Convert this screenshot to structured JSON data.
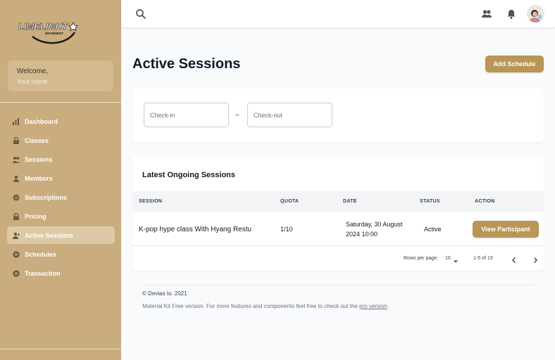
{
  "colors": {
    "sidebar": "#c9ad7f",
    "accent": "#b99655",
    "active_nav": "#ddc9a6"
  },
  "brand": {
    "logo_text": "LIMELIGHT",
    "logo_subtext": "MOVEMENT"
  },
  "welcome": {
    "title": "Welcome,",
    "name": "Your name"
  },
  "sidebar": {
    "items": [
      {
        "label": "Dashboard",
        "icon": "bar-chart-icon",
        "active": false
      },
      {
        "label": "Classes",
        "icon": "lock-icon",
        "active": false
      },
      {
        "label": "Sessions",
        "icon": "users-icon",
        "active": false
      },
      {
        "label": "Members",
        "icon": "user-icon",
        "active": false
      },
      {
        "label": "Subscriptions",
        "icon": "gear-icon",
        "active": false
      },
      {
        "label": "Pricing",
        "icon": "lock-icon",
        "active": false
      },
      {
        "label": "Active Sessions",
        "icon": "user-add-icon",
        "active": true
      },
      {
        "label": "Schedules",
        "icon": "cancel-circle-icon",
        "active": false
      },
      {
        "label": "Transaction",
        "icon": "cancel-circle-icon",
        "active": false
      }
    ]
  },
  "topbar": {
    "icons": [
      "search-icon",
      "users-icon",
      "bell-icon",
      "avatar"
    ]
  },
  "page": {
    "title": "Active Sessions",
    "add_button": "Add Schedule"
  },
  "filters": {
    "checkin_placeholder": "Check-in",
    "separator": "–",
    "checkout_placeholder": "Check-out"
  },
  "table": {
    "title": "Latest Ongoing Sessions",
    "headers": [
      "SESSION",
      "QUOTA",
      "DATE",
      "STATUS",
      "ACTION"
    ],
    "rows": [
      {
        "session": "K-pop hype class With Hyang Restu",
        "quota": "1/10",
        "date_line1": "Saturday, 30 August",
        "date_line2": "2024 10:00",
        "status": "Active",
        "action": "View Participant"
      }
    ],
    "pagination": {
      "rows_per_page_label": "Rows per page:",
      "rows_per_page": "10",
      "range": "1-5 of 13"
    }
  },
  "footer": {
    "copyright": "© Devias Io. 2021",
    "text": "Material Kit Free version. For more features and components feel free to check out the ",
    "link": "pro version",
    "suffix": "."
  }
}
